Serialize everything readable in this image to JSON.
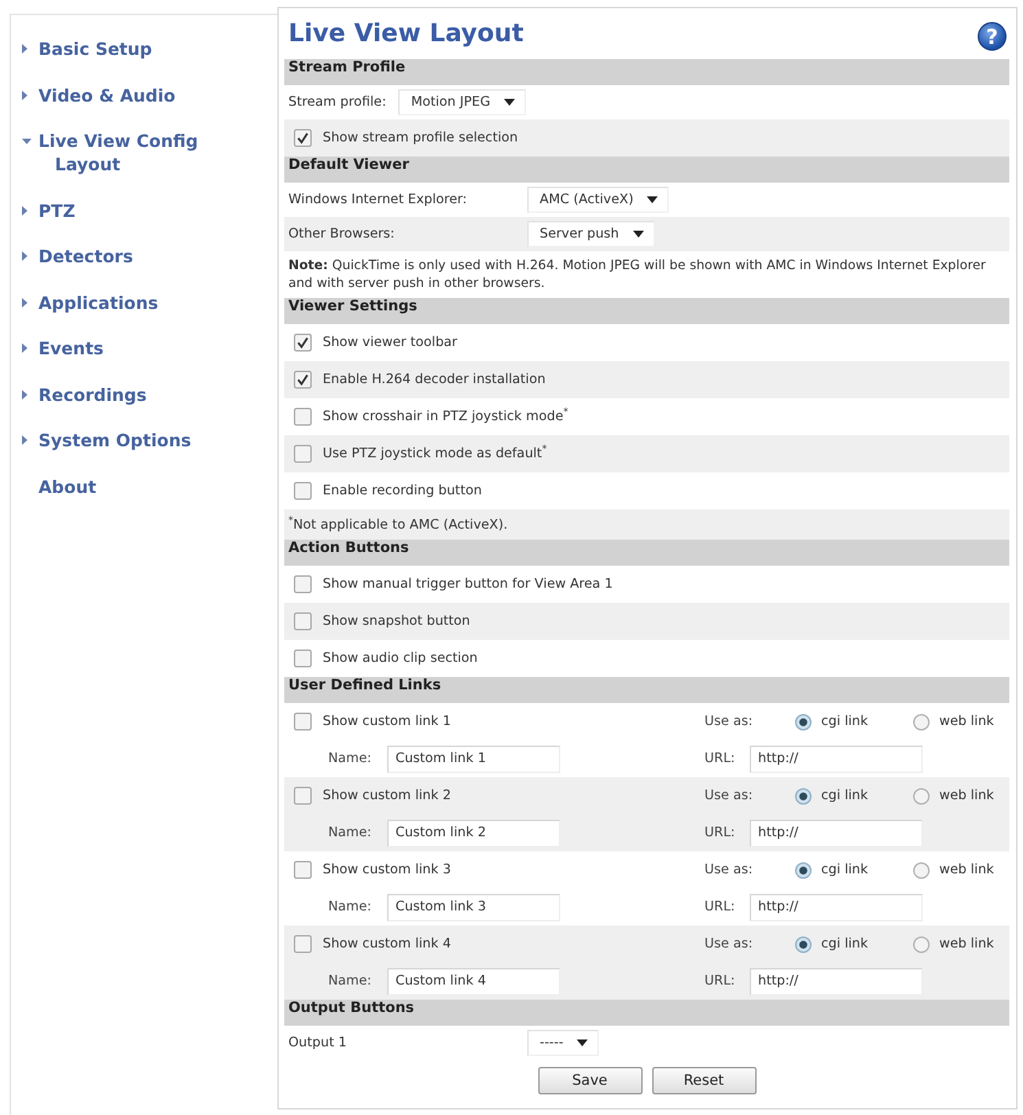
{
  "sidebar": {
    "items": [
      {
        "label": "Basic Setup",
        "kind": "menu",
        "expanded": false
      },
      {
        "label": "Video & Audio",
        "kind": "menu",
        "expanded": false
      },
      {
        "label": "Live View Config",
        "kind": "menu",
        "expanded": true,
        "children": [
          {
            "label": "Layout"
          }
        ]
      },
      {
        "label": "PTZ",
        "kind": "menu",
        "expanded": false
      },
      {
        "label": "Detectors",
        "kind": "menu",
        "expanded": false
      },
      {
        "label": "Applications",
        "kind": "menu",
        "expanded": false
      },
      {
        "label": "Events",
        "kind": "menu",
        "expanded": false
      },
      {
        "label": "Recordings",
        "kind": "menu",
        "expanded": false
      },
      {
        "label": "System Options",
        "kind": "menu",
        "expanded": false
      },
      {
        "label": "About",
        "kind": "link"
      }
    ]
  },
  "main": {
    "title": "Live View Layout",
    "help": "?",
    "sections": [
      {
        "title": "Stream Profile",
        "rows": [
          {
            "kind": "inline_select",
            "label": "Stream profile:",
            "value": "Motion JPEG"
          },
          {
            "kind": "checkbox",
            "label": "Show stream profile selection",
            "checked": true
          }
        ]
      },
      {
        "title": "Default Viewer",
        "rows": [
          {
            "kind": "select",
            "label": "Windows Internet Explorer:",
            "value": "AMC (ActiveX)"
          },
          {
            "kind": "select",
            "label": "Other Browsers:",
            "value": "Server push"
          },
          {
            "kind": "note",
            "text": "**Note:** QuickTime is only used with H.264. Motion JPEG will be shown with AMC in Windows Internet Explorer and with server push in other browsers."
          }
        ]
      },
      {
        "title": "Viewer Settings",
        "rows": [
          {
            "kind": "checkbox",
            "label": "Show viewer toolbar",
            "checked": true
          },
          {
            "kind": "checkbox",
            "label": "Enable H.264 decoder installation",
            "checked": true
          },
          {
            "kind": "checkbox",
            "label": "Show crosshair in PTZ joystick mode$^{*}$",
            "checked": false
          },
          {
            "kind": "checkbox",
            "label": "Use PTZ joystick mode as default$^{*}$",
            "checked": false
          },
          {
            "kind": "checkbox",
            "label": "Enable recording button",
            "checked": false
          },
          {
            "kind": "footnote",
            "text": "$^{*}$Not applicable to AMC (ActiveX)."
          }
        ]
      },
      {
        "title": "Action Buttons",
        "rows": [
          {
            "kind": "checkbox",
            "label": "Show manual trigger button for View Area 1",
            "checked": false
          },
          {
            "kind": "checkbox",
            "label": "Show snapshot button",
            "checked": false
          },
          {
            "kind": "checkbox",
            "label": "Show audio clip section",
            "checked": false
          }
        ]
      },
      {
        "title": "User Defined Links",
        "rows": [
          {
            "kind": "custom_link",
            "label": "Show custom link 1",
            "checked": false,
            "use_as": "Use as:",
            "options": [
              {
                "label": "cgi link",
                "selected": true
              },
              {
                "label": "web link",
                "selected": false
              }
            ],
            "name_label": "Name:",
            "name": "Custom link 1",
            "url_label": "URL:",
            "url": "http://"
          },
          {
            "kind": "custom_link",
            "label": "Show custom link 2",
            "checked": false,
            "use_as": "Use as:",
            "options": [
              {
                "label": "cgi link",
                "selected": true
              },
              {
                "label": "web link",
                "selected": false
              }
            ],
            "name_label": "Name:",
            "name": "Custom link 2",
            "url_label": "URL:",
            "url": "http://"
          },
          {
            "kind": "custom_link",
            "label": "Show custom link 3",
            "checked": false,
            "use_as": "Use as:",
            "options": [
              {
                "label": "cgi link",
                "selected": true
              },
              {
                "label": "web link",
                "selected": false
              }
            ],
            "name_label": "Name:",
            "name": "Custom link 3",
            "url_label": "URL:",
            "url": "http://"
          },
          {
            "kind": "custom_link",
            "label": "Show custom link 4",
            "checked": false,
            "use_as": "Use as:",
            "options": [
              {
                "label": "cgi link",
                "selected": true
              },
              {
                "label": "web link",
                "selected": false
              }
            ],
            "name_label": "Name:",
            "name": "Custom link 4",
            "url_label": "URL:",
            "url": "http://"
          }
        ]
      },
      {
        "title": "Output Buttons",
        "rows": [
          {
            "kind": "select",
            "label": "Output 1",
            "value": "-----"
          }
        ]
      }
    ],
    "buttons": {
      "save": "Save",
      "reset": "Reset"
    }
  }
}
